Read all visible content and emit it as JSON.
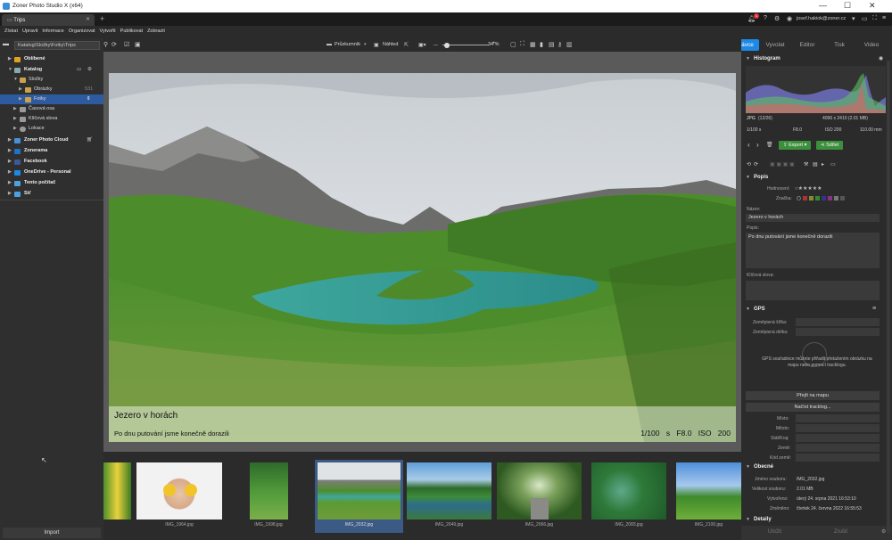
{
  "window": {
    "title": "Zoner Photo Studio X (x64)",
    "minimize": "—",
    "maximize": "☐",
    "close": "✕"
  },
  "tabs": [
    {
      "label": "Trips"
    }
  ],
  "account": {
    "email": "josef.hakiok@zoner.cz",
    "badge": "1"
  },
  "menu": [
    "Získat",
    "Upravit",
    "Informace",
    "Organizovat",
    "Vytvořit",
    "Publikovat",
    "Zobrazit"
  ],
  "modes": [
    "Správce",
    "Vyvolat",
    "Editor",
    "Tisk",
    "Video"
  ],
  "active_mode": "Správce",
  "sidebar": {
    "path": "Katalog\\Složky\\Fotky\\Trips",
    "items": [
      {
        "label": "Oblíbené",
        "bold": true
      },
      {
        "label": "Katalog",
        "bold": true
      },
      {
        "label": "Složky"
      },
      {
        "label": "Obrázky",
        "count": "531"
      },
      {
        "label": "Fotky"
      },
      {
        "label": "Časová osa"
      },
      {
        "label": "Klíčová slova"
      },
      {
        "label": "Lokace"
      },
      {
        "label": "Zoner Photo Cloud",
        "bold": true
      },
      {
        "label": "Zonerama",
        "bold": true
      },
      {
        "label": "Facebook",
        "bold": true
      },
      {
        "label": "OneDrive - Personal",
        "bold": true
      },
      {
        "label": "Tento počítač",
        "bold": true
      },
      {
        "label": "Síť",
        "bold": true
      }
    ],
    "import_label": "Import"
  },
  "toolbar": {
    "browser_label": "Průzkumník",
    "preview_label": "Náhled",
    "zoom": "34 %"
  },
  "viewer": {
    "caption_title": "Jezero v horách",
    "caption_desc": "Po dnu putování jsme konečně dorazili",
    "exif": "1/100 s  F8.0  ISO 200"
  },
  "filmstrip": [
    {
      "name": ""
    },
    {
      "name": "IMG_1964.jpg"
    },
    {
      "name": "IMG_1998.jpg"
    },
    {
      "name": "IMG_2032.jpg"
    },
    {
      "name": "IMG_2049.jpg"
    },
    {
      "name": "IMG_2066.jpg"
    },
    {
      "name": "IMG_2083.jpg"
    },
    {
      "name": "IMG_2100.jpg"
    }
  ],
  "right": {
    "histogram_title": "Histogram",
    "file_type": "JPG",
    "file_index": "(12/26)",
    "dimensions": "4096 x 2410 (2.01 MB)",
    "shutter": "1/100 s",
    "aperture": "F8.0",
    "iso": "ISO 200",
    "focal": "110.00 mm",
    "export_label": "Export",
    "share_label": "Sdílet",
    "popis_title": "Popis",
    "rating_label": "Hodnocení:",
    "label_label": "Značka:",
    "name_label": "Název:",
    "name_value": "Jezero v horách",
    "desc_label": "Popis:",
    "desc_value": "Po dnu putování jsme konečně dorazili",
    "keywords_label": "Klíčová slova:",
    "gps_title": "GPS",
    "lat_label": "Zeměpisná šířka:",
    "lon_label": "Zeměpisná délka:",
    "gps_note_1": "GPS souřadnice můžete přiřadit přetažením obrázku na",
    "gps_note_2": "mapu nebo pomocí tracklogu.",
    "go_map": "Přejít na mapu",
    "load_track": "Načíst tracklog...",
    "place_label": "Místo:",
    "city_label": "Město:",
    "state_label": "Stát/Kraj:",
    "country_label": "Země:",
    "country_code_label": "Kód země:",
    "general_title": "Obecné",
    "file_name_label": "Jméno souboru:",
    "file_name_value": "IMG_2032.jpg",
    "file_size_label": "Velikost souboru:",
    "file_size_value": "2.01 MB",
    "created_label": "Vytvořeno:",
    "created_value": "úterý 24. srpna 2021 16:53:10",
    "modified_label": "Změněno:",
    "modified_value": "čtvrtek 24. června 2022 16:55:53",
    "details_title": "Detaily",
    "save_label": "Uložit",
    "reset_label": "Zrušit"
  },
  "colors": {
    "accent": "#1e88e5",
    "selection": "#2e5aa0",
    "green_button": "#3c8f3c"
  }
}
